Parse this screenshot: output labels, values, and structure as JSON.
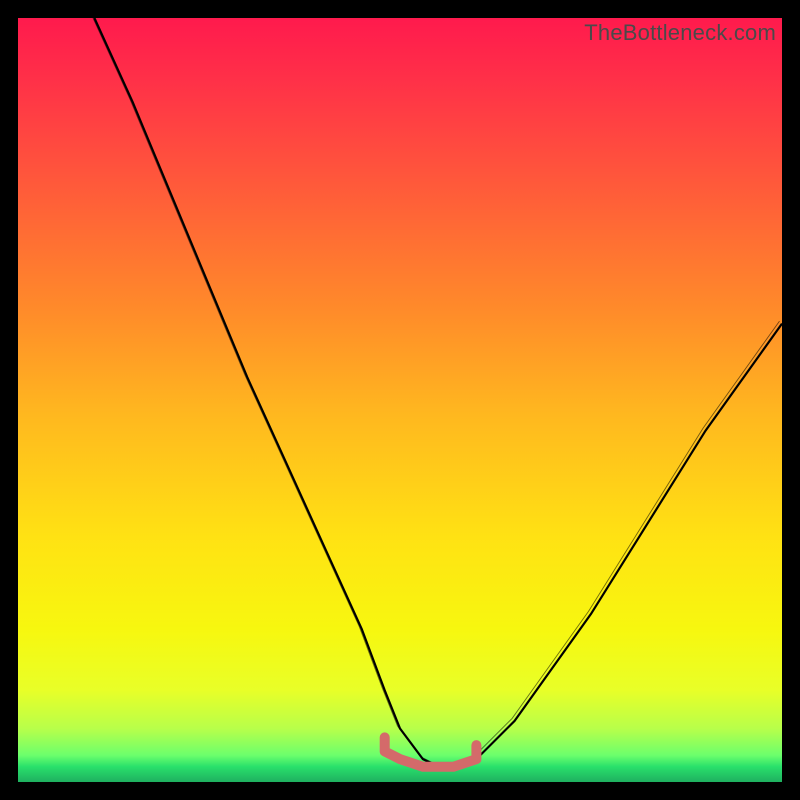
{
  "watermark": "TheBottleneck.com",
  "colors": {
    "frame": "#000000",
    "top": "#ff1a4d",
    "mid": "#ffe213",
    "bottom": "#1fb060",
    "curve": "#000000",
    "tolerance": "#d46a6a"
  },
  "chart_data": {
    "type": "line",
    "title": "",
    "xlabel": "",
    "ylabel": "",
    "xlim": [
      0,
      100
    ],
    "ylim": [
      0,
      100
    ],
    "grid": false,
    "legend": false,
    "series": [
      {
        "name": "bottleneck-curve",
        "x": [
          10,
          15,
          20,
          25,
          30,
          35,
          40,
          45,
          48,
          50,
          53,
          55,
          57,
          60,
          65,
          70,
          75,
          80,
          85,
          90,
          95,
          100
        ],
        "y": [
          100,
          89,
          77,
          65,
          53,
          42,
          31,
          20,
          12,
          7,
          3,
          2,
          2,
          3,
          8,
          15,
          22,
          30,
          38,
          46,
          53,
          60
        ]
      }
    ],
    "tolerance_band": {
      "x": [
        48,
        50,
        53,
        55,
        57,
        60
      ],
      "y": [
        4,
        3,
        2,
        2,
        2,
        3
      ]
    }
  }
}
